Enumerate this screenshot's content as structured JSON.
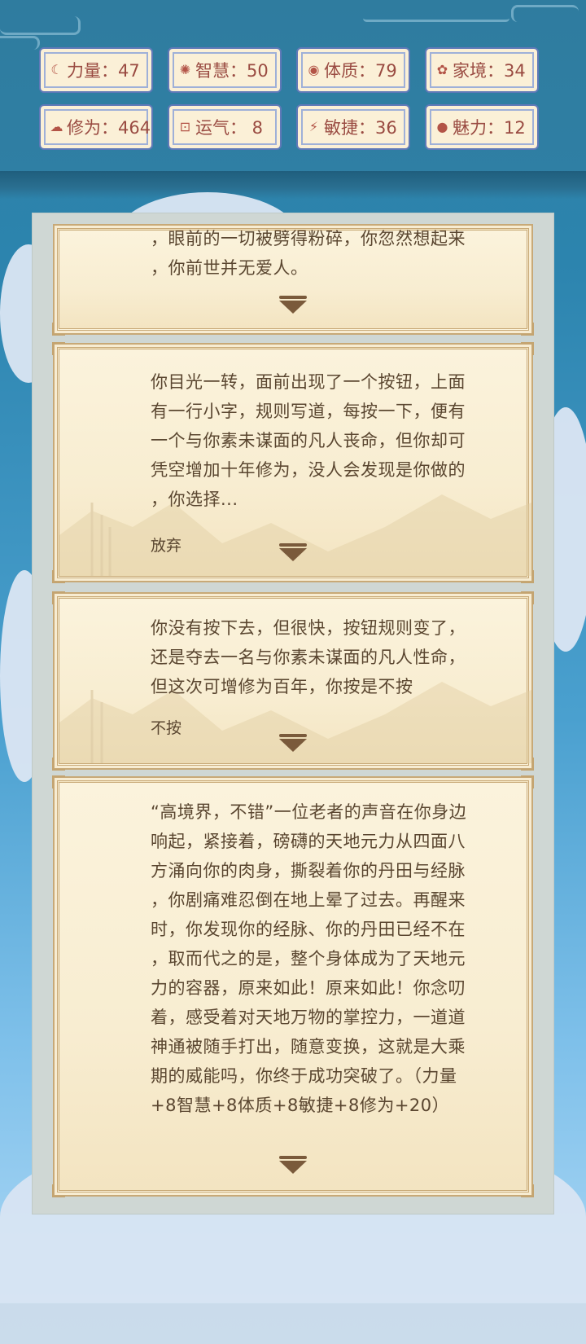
{
  "stats": [
    {
      "icon": "strength-icon",
      "glyph": "☾",
      "label": "力量：47"
    },
    {
      "icon": "wisdom-icon",
      "glyph": "✺",
      "label": "智慧：50"
    },
    {
      "icon": "constitution-icon",
      "glyph": "◉",
      "label": "体质：79"
    },
    {
      "icon": "family-icon",
      "glyph": "✿",
      "label": "家境：34"
    },
    {
      "icon": "cultivation-icon",
      "glyph": "☁",
      "label": "修为：464"
    },
    {
      "icon": "luck-icon",
      "glyph": "⊡",
      "label": "运气： 8"
    },
    {
      "icon": "agility-icon",
      "glyph": "⚡",
      "label": "敏捷：36"
    },
    {
      "icon": "charm-icon",
      "glyph": "●",
      "label": "魅力：12"
    }
  ],
  "cards": [
    {
      "text": "，眼前的一切被劈得粉碎，你忽然想起来\n，你前世并无爱人。",
      "choice": ""
    },
    {
      "text": "你目光一转，面前出现了一个按钮，上面\n有一行小字，规则写道，每按一下，便有\n一个与你素未谋面的凡人丧命，但你却可\n凭空增加十年修为，没人会发现是你做的\n，你选择...",
      "choice": "放弃"
    },
    {
      "text": "你没有按下去，但很快，按钮规则变了，\n还是夺去一名与你素未谋面的凡人性命，\n但这次可增修为百年，你按是不按",
      "choice": "不按"
    },
    {
      "text": "“高境界，不错”一位老者的声音在你身边\n响起，紧接着，磅礴的天地元力从四面八\n方涌向你的肉身，撕裂着你的丹田与经脉\n，你剧痛难忍倒在地上晕了过去。再醒来\n时，你发现你的经脉、你的丹田已经不在\n，取而代之的是，整个身体成为了天地元\n力的容器，原来如此！原来如此！你念叨\n着，感受着对天地万物的掌控力，一道道\n神通被随手打出，随意变换，这就是大乘\n期的威能吗，你终于成功突破了。（力量\n+8智慧+8体质+8敏捷+8修为+20）",
      "choice": ""
    }
  ]
}
